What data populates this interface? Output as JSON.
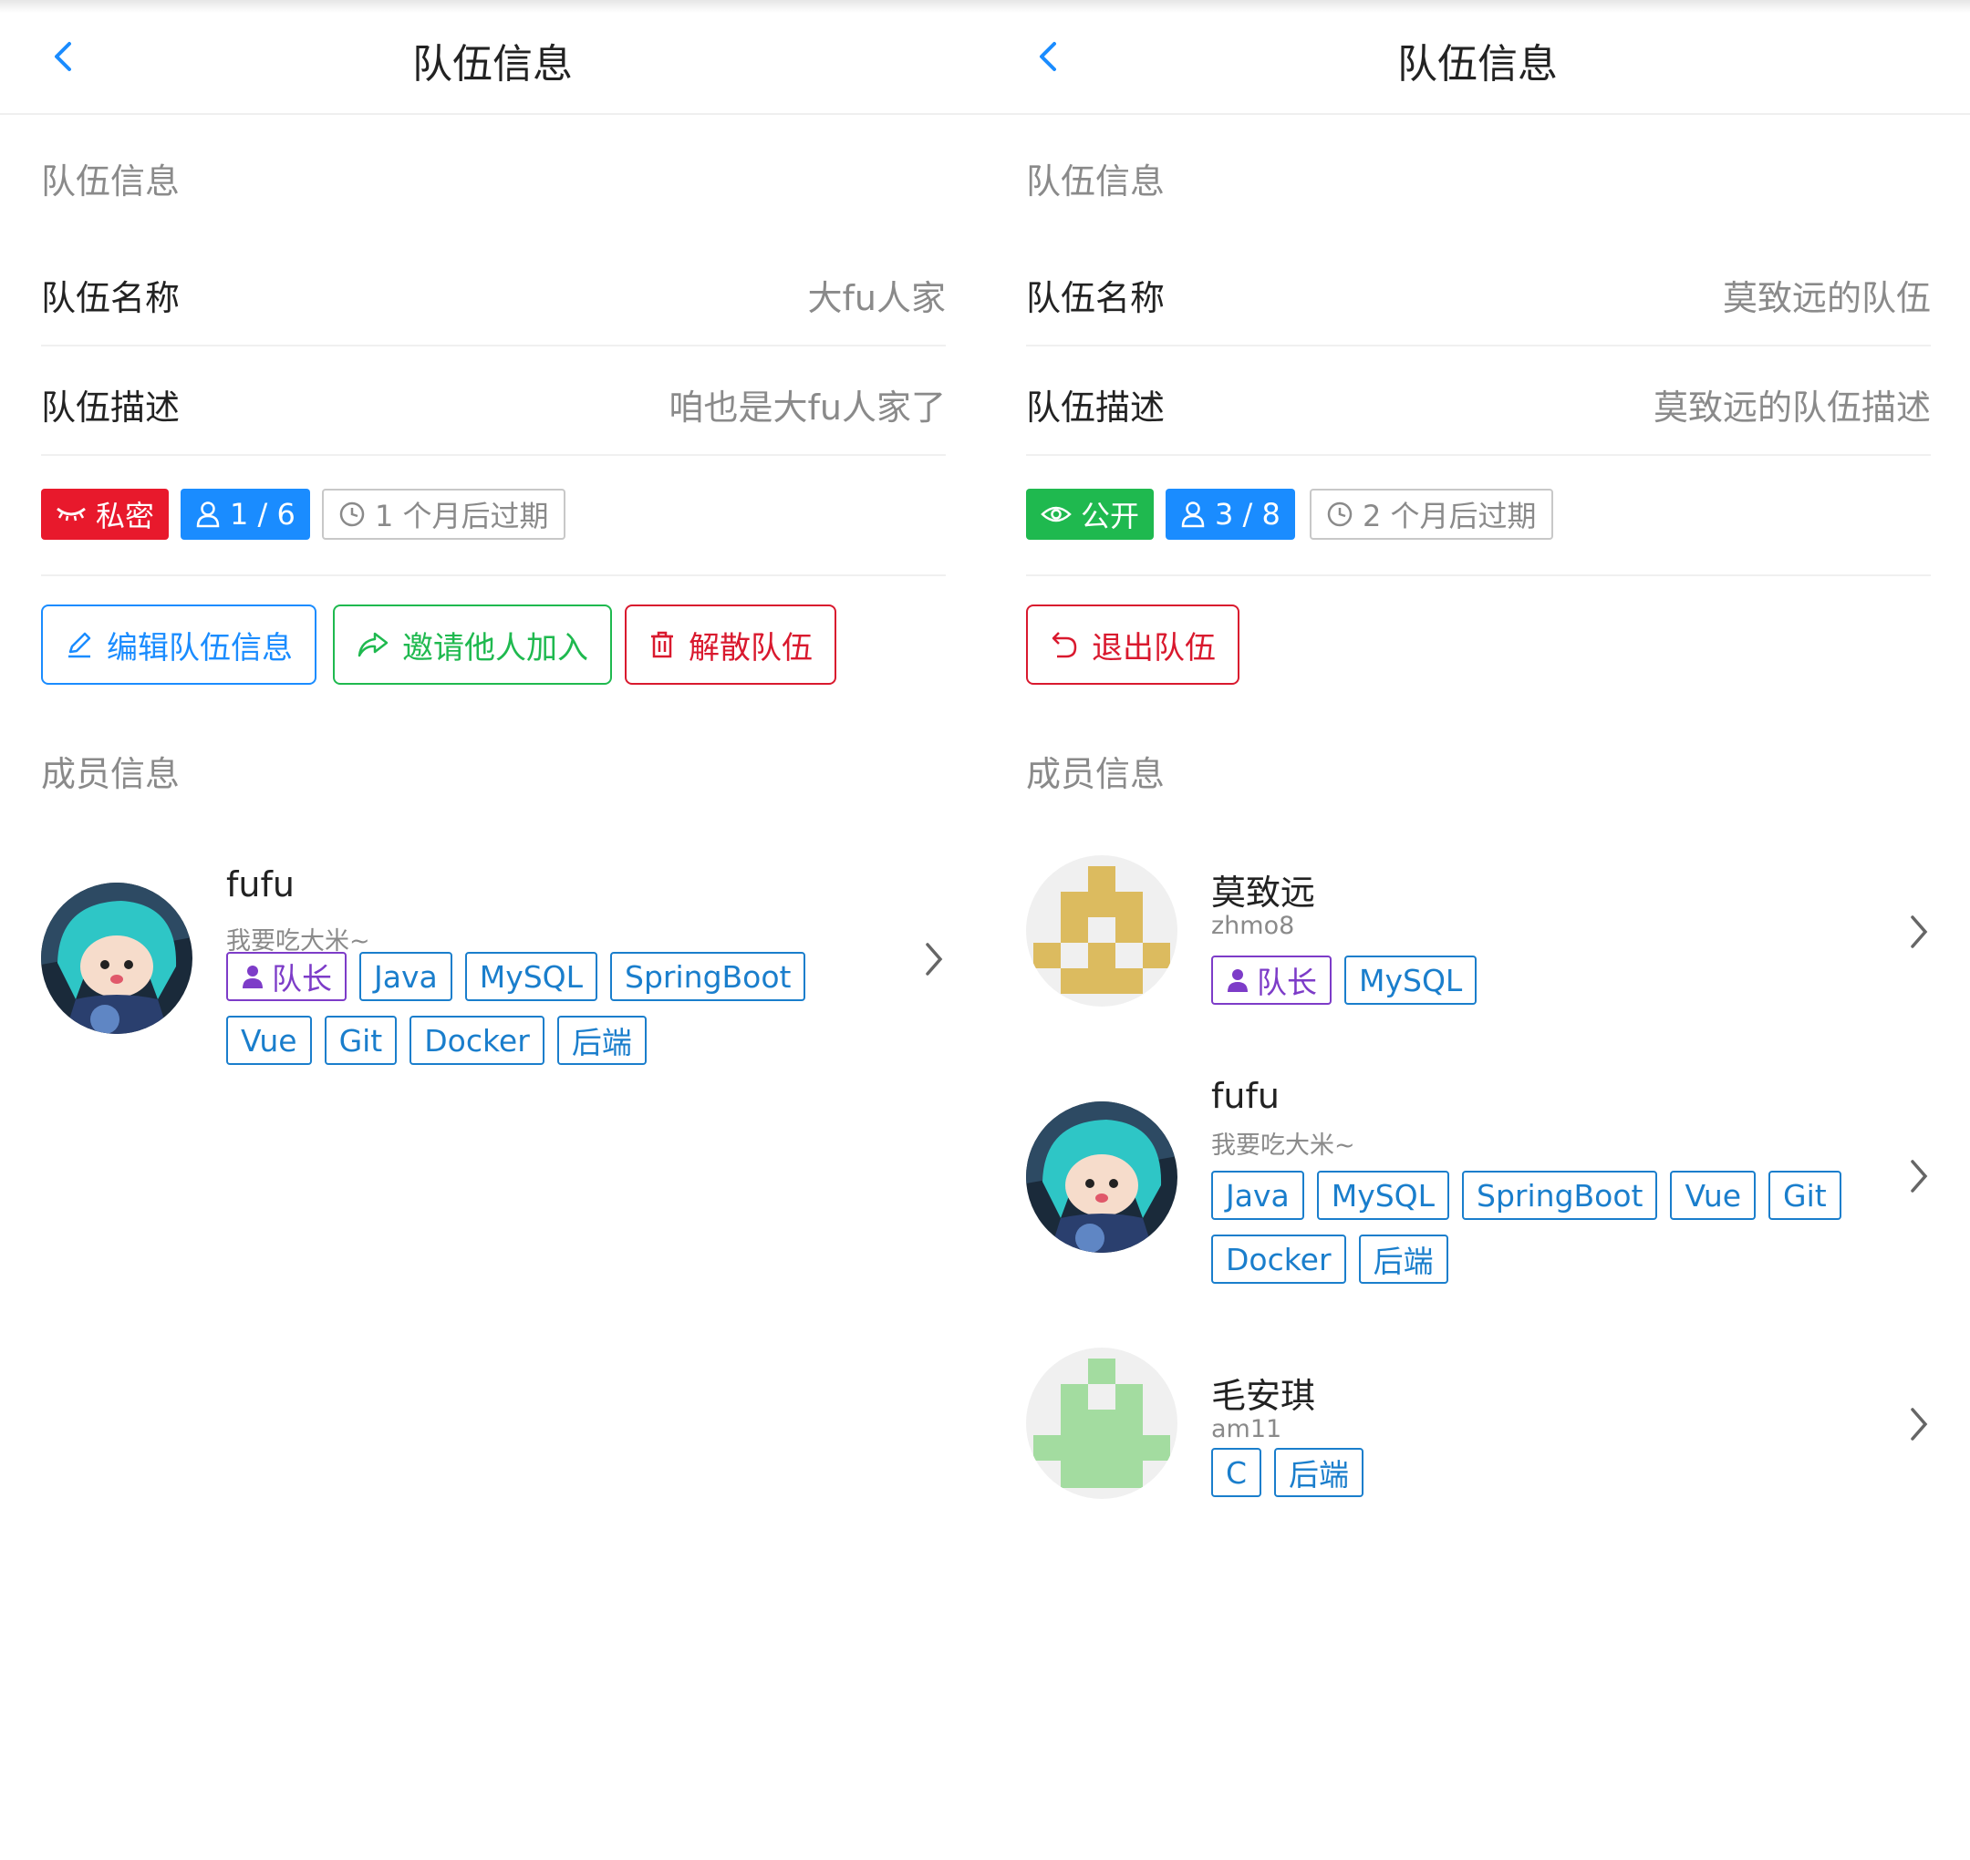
{
  "panels": [
    {
      "nav_title": "队伍信息",
      "section_team": "队伍信息",
      "name_label": "队伍名称",
      "name_value": "大fu人家",
      "desc_label": "队伍描述",
      "desc_value": "咱也是大fu人家了",
      "status_badge": "私密",
      "count_badge": "1 / 6",
      "expire_badge": "1 个月后过期",
      "actions": [
        "编辑队伍信息",
        "邀请他人加入",
        "解散队伍"
      ],
      "section_members": "成员信息",
      "members": [
        {
          "name": "fufu",
          "sub": "我要吃大米~",
          "avatar": "anime-plush-avatar",
          "tag_rows": [
            [
              "队长",
              "Java",
              "MySQL",
              "SpringBoot"
            ],
            [
              "Vue",
              "Git",
              "Docker",
              "后端"
            ]
          ]
        }
      ]
    },
    {
      "nav_title": "队伍信息",
      "section_team": "队伍信息",
      "name_label": "队伍名称",
      "name_value": "莫致远的队伍",
      "desc_label": "队伍描述",
      "desc_value": "莫致远的队伍描述",
      "status_badge": "公开",
      "count_badge": "3 / 8",
      "expire_badge": "2 个月后过期",
      "actions": [
        "退出队伍"
      ],
      "section_members": "成员信息",
      "members": [
        {
          "name": "莫致远",
          "sub": "zhmo8",
          "avatar": "identicon-gold",
          "tag_rows": [
            [
              "队长",
              "MySQL"
            ]
          ]
        },
        {
          "name": "fufu",
          "sub": "我要吃大米~",
          "avatar": "anime-plush-avatar",
          "tag_rows": [
            [
              "Java",
              "MySQL",
              "SpringBoot",
              "Vue",
              "Git"
            ],
            [
              "Docker",
              "后端"
            ]
          ]
        },
        {
          "name": "毛安琪",
          "sub": "am11",
          "avatar": "identicon-green",
          "tag_rows": [
            [
              "C",
              "后端"
            ]
          ]
        }
      ]
    }
  ],
  "colors": {
    "primary": "#1a8cff",
    "success": "#1fb94f",
    "danger": "#e8192c",
    "tag": "#1a7ecc",
    "leader": "#7d3cc8",
    "muted": "#8a8a8a",
    "identicon_gold": "#dcbb5f",
    "identicon_green": "#a3dca0"
  }
}
